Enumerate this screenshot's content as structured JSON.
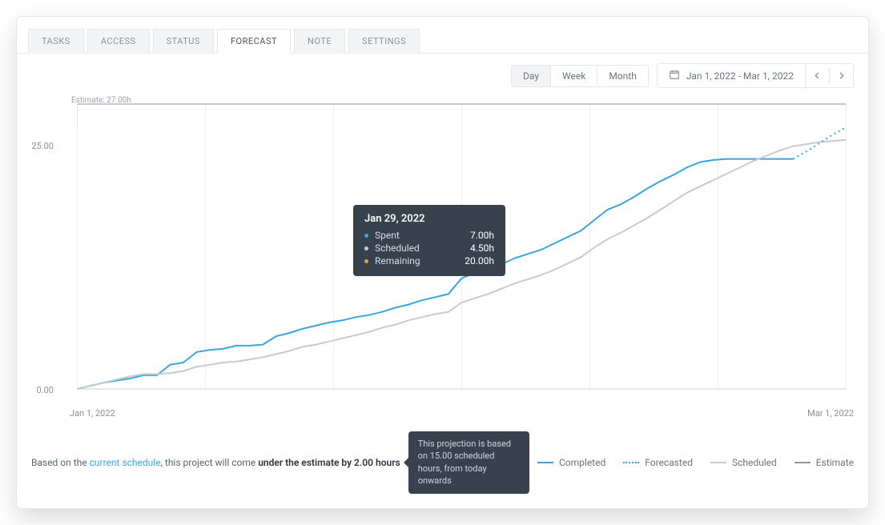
{
  "tabs": [
    "TASKS",
    "ACCESS",
    "STATUS",
    "FORECAST",
    "NOTE",
    "SETTINGS"
  ],
  "active_tab": 3,
  "view_modes": [
    "Day",
    "Week",
    "Month"
  ],
  "active_view_mode": 0,
  "date_range": "Jan 1, 2022 - Mar 1, 2022",
  "estimate_tag": "Estimate: 27.00h",
  "y_ticks": [
    "25.00",
    "0.00"
  ],
  "x_start": "Jan 1, 2022",
  "x_end": "Mar 1, 2022",
  "tooltip": {
    "date": "Jan 29, 2022",
    "spent_label": "Spent",
    "spent": "7.00h",
    "scheduled_label": "Scheduled",
    "scheduled": "4.50h",
    "remaining_label": "Remaining",
    "remaining": "20.00h"
  },
  "footer": {
    "prefix": "Based on the ",
    "link": "current schedule",
    "mid": ", this project will come ",
    "bold": "under the estimate by 2.00 hours",
    "balloon": "This projection is based on 15.00 scheduled hours, from today onwards"
  },
  "legend": [
    {
      "label": "Completed",
      "color": "#3aa5de",
      "style": "solid"
    },
    {
      "label": "Forecasted",
      "color": "#3aa5de",
      "style": "dashed"
    },
    {
      "label": "Scheduled",
      "color": "#c5cbd0",
      "style": "solid"
    },
    {
      "label": "Estimate",
      "color": "#8a929a",
      "style": "solid"
    }
  ],
  "chart_data": {
    "type": "line",
    "title": "",
    "xlabel": "",
    "ylabel": "",
    "x_range": [
      "Jan 1, 2022",
      "Mar 1, 2022"
    ],
    "ylim": [
      0,
      27
    ],
    "estimate_value": 27.0,
    "series": [
      {
        "name": "Completed",
        "color": "#3aa5de",
        "x": [
          0,
          1,
          2,
          3,
          4,
          5,
          6,
          7,
          8,
          9,
          10,
          11,
          12,
          13,
          14,
          15,
          16,
          17,
          18,
          19,
          20,
          21,
          22,
          23,
          24,
          25,
          26,
          27,
          28,
          29,
          30,
          31,
          32,
          33,
          34,
          35,
          36,
          37,
          38,
          39,
          40,
          41,
          42,
          43,
          44,
          45,
          46,
          47,
          48,
          49,
          50,
          51,
          52,
          53,
          54
        ],
        "values": [
          0,
          0.3,
          0.6,
          0.8,
          1.0,
          1.3,
          1.3,
          2.3,
          2.5,
          3.5,
          3.7,
          3.8,
          4.1,
          4.1,
          4.2,
          5.0,
          5.3,
          5.7,
          6.0,
          6.3,
          6.5,
          6.8,
          7.0,
          7.3,
          7.7,
          8.0,
          8.4,
          8.7,
          9.0,
          10.5,
          11.0,
          11.4,
          11.8,
          12.4,
          12.8,
          13.2,
          13.8,
          14.4,
          15.0,
          16.0,
          17.0,
          17.5,
          18.2,
          19.0,
          19.7,
          20.3,
          21.0,
          21.5,
          21.7,
          21.8,
          21.8,
          21.8,
          21.8,
          21.8,
          21.8
        ]
      },
      {
        "name": "Scheduled",
        "color": "#c5cbd0",
        "x": [
          0,
          1,
          2,
          3,
          4,
          5,
          6,
          7,
          8,
          9,
          10,
          11,
          12,
          13,
          14,
          15,
          16,
          17,
          18,
          19,
          20,
          21,
          22,
          23,
          24,
          25,
          26,
          27,
          28,
          29,
          30,
          31,
          32,
          33,
          34,
          35,
          36,
          37,
          38,
          39,
          40,
          41,
          42,
          43,
          44,
          45,
          46,
          47,
          48,
          49,
          50,
          51,
          52,
          53,
          54,
          55,
          56,
          57,
          58
        ],
        "values": [
          0,
          0.3,
          0.6,
          0.9,
          1.2,
          1.4,
          1.4,
          1.5,
          1.7,
          2.1,
          2.3,
          2.5,
          2.6,
          2.8,
          3.0,
          3.3,
          3.6,
          4.0,
          4.2,
          4.5,
          4.8,
          5.1,
          5.4,
          5.8,
          6.1,
          6.5,
          6.8,
          7.1,
          7.3,
          8.2,
          8.6,
          9.0,
          9.5,
          10.0,
          10.4,
          10.8,
          11.3,
          11.9,
          12.5,
          13.4,
          14.2,
          14.8,
          15.5,
          16.2,
          17.0,
          17.8,
          18.6,
          19.2,
          19.8,
          20.4,
          21.0,
          21.6,
          22.1,
          22.6,
          23.0,
          23.2,
          23.4,
          23.5,
          23.6
        ]
      },
      {
        "name": "Forecasted",
        "color": "#3aa5de",
        "style": "dashed",
        "x": [
          54,
          55,
          56,
          57,
          58
        ],
        "values": [
          21.8,
          22.5,
          23.3,
          24.1,
          24.8
        ]
      },
      {
        "name": "Estimate",
        "color": "#8a929a",
        "x": [
          0,
          58
        ],
        "values": [
          27.0,
          27.0
        ]
      }
    ]
  }
}
